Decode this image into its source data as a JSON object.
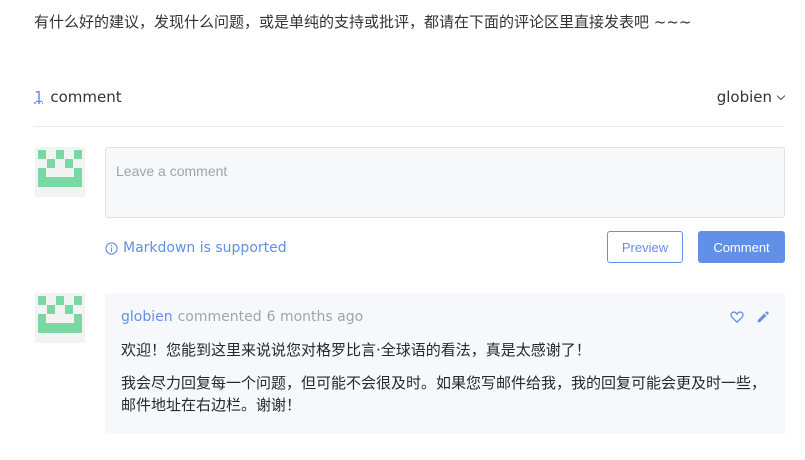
{
  "intro": {
    "text": "有什么好的建议，发现什么问题，或是单纯的支持或批评，都请在下面的评论区里直接发表吧 ~~~"
  },
  "header": {
    "count": "1",
    "count_label": "comment",
    "user": "globien"
  },
  "composer": {
    "placeholder": "Leave a comment",
    "markdown_hint": "Markdown is supported",
    "preview_label": "Preview",
    "comment_label": "Comment"
  },
  "comments": [
    {
      "author": "globien",
      "verb": "commented",
      "time": "6 months ago",
      "paragraphs": [
        "欢迎！您能到这里来说说您对格罗比言·全球语的看法，真是太感谢了！",
        "我会尽力回复每一个问题，但可能不会很及时。如果您写邮件给我，我的回复可能会更及时一些，邮件地址在右边栏。谢谢！"
      ]
    }
  ],
  "colors": {
    "accent": "#6190e8",
    "avatar_green": "#7ad9a3"
  },
  "icons": {
    "info": "info-circle-icon",
    "heart": "heart-icon",
    "edit": "pencil-icon",
    "chevron": "chevron-down-icon"
  }
}
